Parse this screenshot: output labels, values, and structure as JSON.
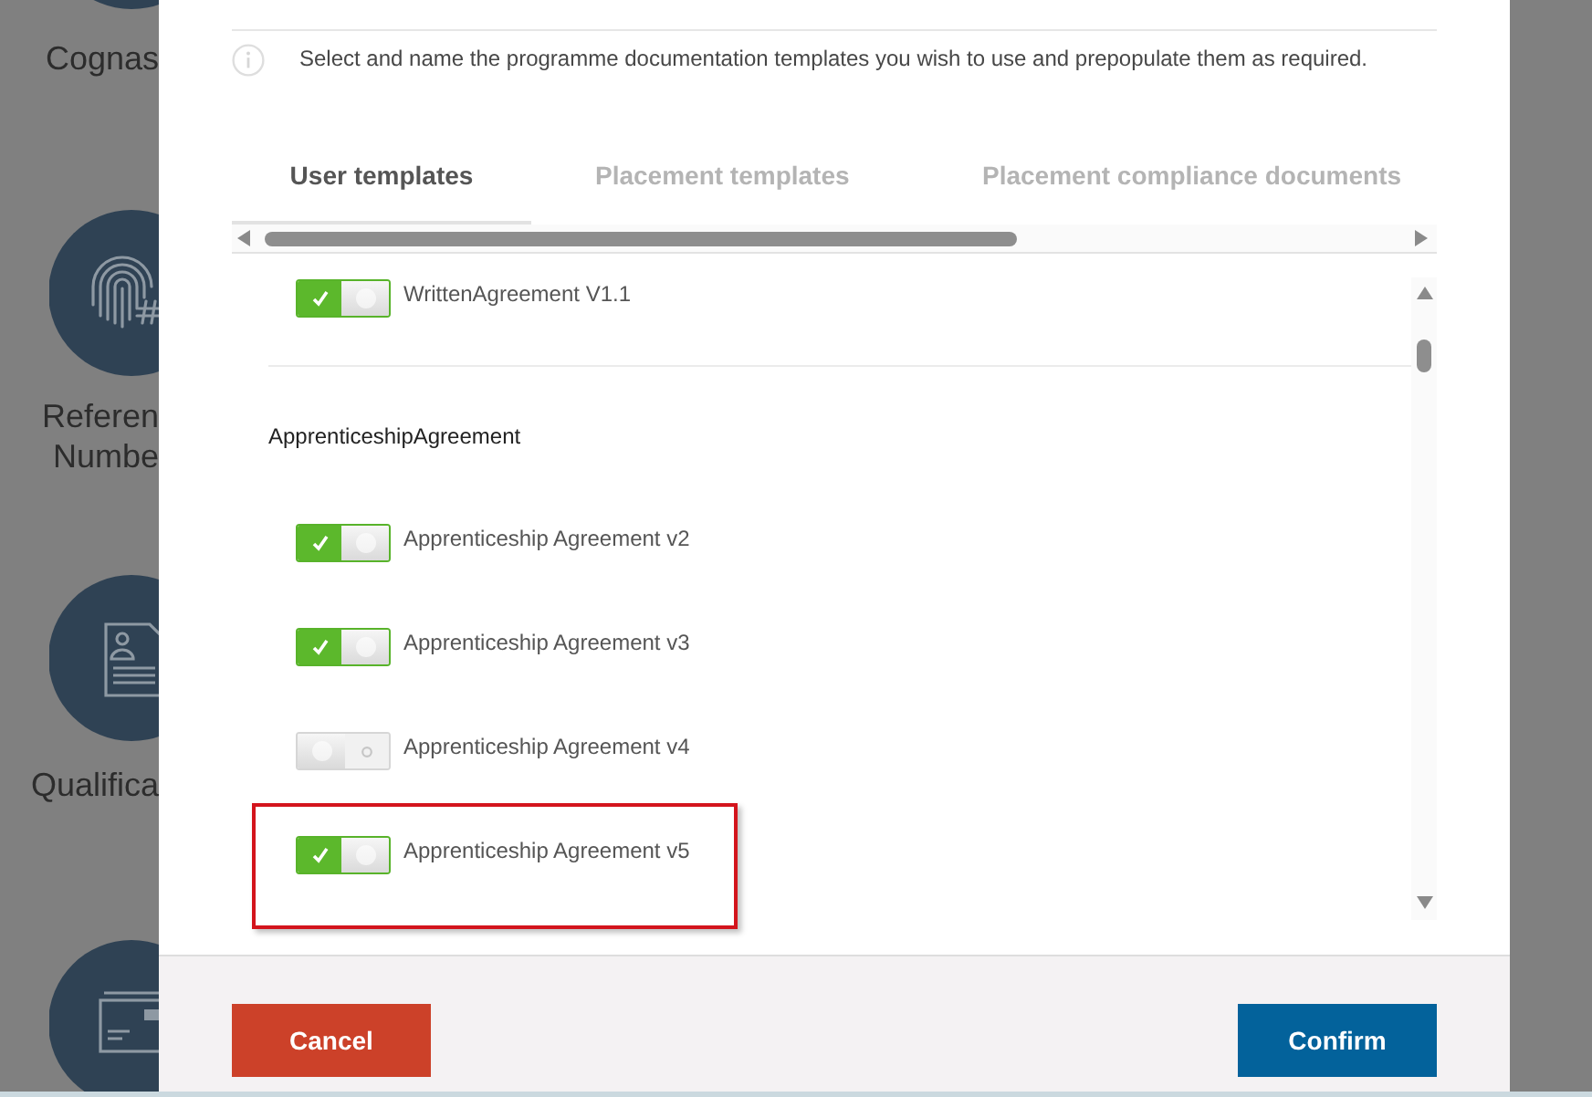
{
  "background_tiles": [
    {
      "label_lines": [
        "Cognas"
      ]
    },
    {
      "label_lines": [
        "Referen",
        "Numbe"
      ]
    },
    {
      "label_lines": [
        "Qualifica"
      ]
    }
  ],
  "dialog": {
    "intro": "Select and name the programme documentation templates you wish to use and prepopulate them as required.",
    "tabs": [
      {
        "label": "User templates",
        "selected": true
      },
      {
        "label": "Placement templates",
        "selected": false
      },
      {
        "label": "Placement compliance documents",
        "selected": false
      }
    ],
    "template_groups": [
      {
        "items": [
          {
            "label": "WrittenAgreement V1.1",
            "on": true,
            "highlighted": false
          }
        ]
      },
      {
        "header": "ApprenticeshipAgreement",
        "items": [
          {
            "label": "Apprenticeship Agreement v2",
            "on": true,
            "highlighted": false
          },
          {
            "label": "Apprenticeship Agreement v3",
            "on": true,
            "highlighted": false
          },
          {
            "label": "Apprenticeship Agreement v4",
            "on": false,
            "highlighted": false
          },
          {
            "label": "Apprenticeship Agreement v5",
            "on": true,
            "highlighted": true
          }
        ]
      }
    ],
    "buttons": [
      {
        "label": "Cancel",
        "kind": "cancel"
      },
      {
        "label": "Confirm",
        "kind": "confirm"
      }
    ]
  }
}
